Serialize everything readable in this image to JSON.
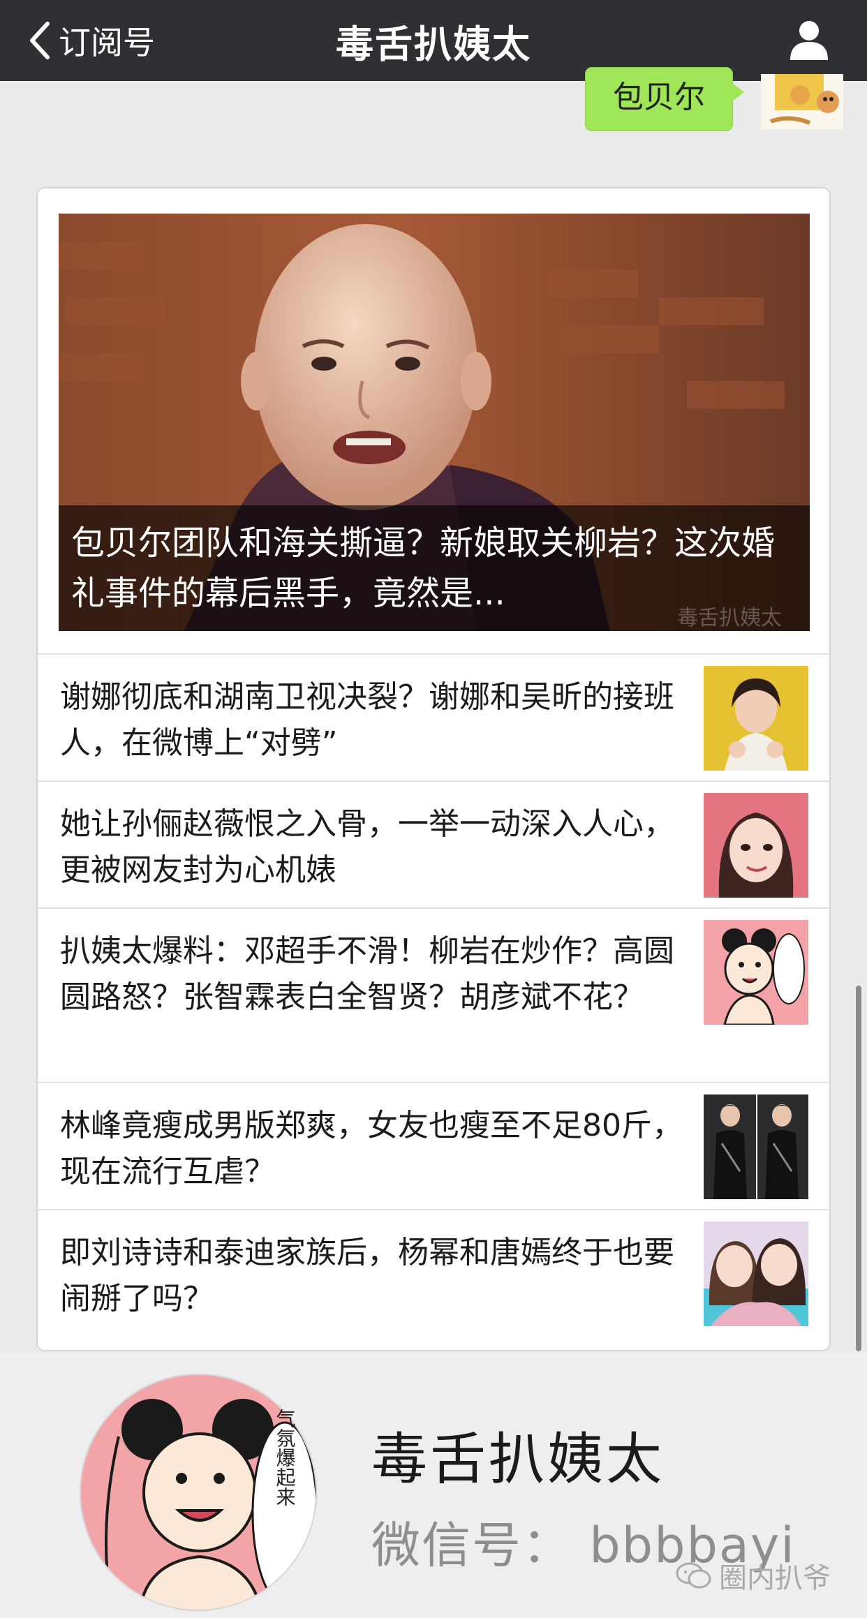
{
  "nav": {
    "back_label": "订阅号",
    "title": "毒舌扒姨太"
  },
  "chat": {
    "bubble_text": "包贝尔"
  },
  "article": {
    "cover_title": "包贝尔团队和海关撕逼？新娘取关柳岩？这次婚礼事件的幕后黑手，竟然是...",
    "cover_watermark": "毒舌扒姨太",
    "items": [
      {
        "title": "谢娜彻底和湖南卫视决裂？谢娜和吴昕的接班人，在微博上“对劈”"
      },
      {
        "title": "她让孙俪赵薇恨之入骨，一举一动深入人心，更被网友封为心机婊"
      },
      {
        "title": "扒姨太爆料：邓超手不滑！柳岩在炒作？高圆圆路怒？张智霖表白全智贤？胡彦斌不花？"
      },
      {
        "title": "林峰竟瘦成男版郑爽，女友也瘦至不足80斤，现在流行互虐？"
      },
      {
        "title": "即刘诗诗和泰迪家族后，杨幂和唐嫣终于也要闹掰了吗？"
      }
    ]
  },
  "footer": {
    "name": "毒舌扒姨太",
    "wechat_id": "微信号： bbbbayi",
    "avatar_text": "气氛爆起来",
    "watermark": "圈内扒爷"
  },
  "colors": {
    "navbar": "#2f3033",
    "bubble": "#9fe658",
    "background": "#ebebeb"
  }
}
